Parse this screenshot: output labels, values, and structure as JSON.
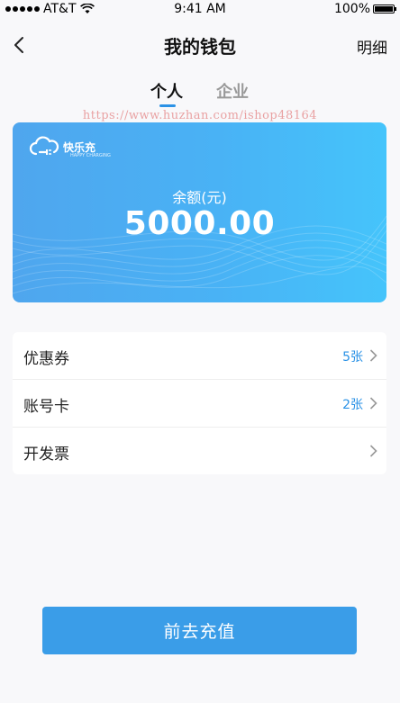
{
  "status_bar": {
    "carrier": "AT&T",
    "time": "9:41 AM",
    "battery": "100%"
  },
  "nav": {
    "title": "我的钱包",
    "detail_label": "明细"
  },
  "tabs": [
    {
      "label": "个人",
      "active": true
    },
    {
      "label": "企业",
      "active": false
    }
  ],
  "watermark": "https://www.huzhan.com/ishop48164",
  "card": {
    "brand": "快乐充",
    "brand_sub": "HAPPY CHARGING",
    "balance_label": "余额(元)",
    "balance": "5000.00"
  },
  "list": [
    {
      "label": "优惠券",
      "value": "5张"
    },
    {
      "label": "账号卡",
      "value": "2张"
    },
    {
      "label": "开发票",
      "value": ""
    }
  ],
  "recharge_button": "前去充值",
  "colors": {
    "accent": "#2b92e6",
    "button": "#3a9de8",
    "card_start": "#4fa6ee",
    "card_end": "#45c4fb"
  }
}
